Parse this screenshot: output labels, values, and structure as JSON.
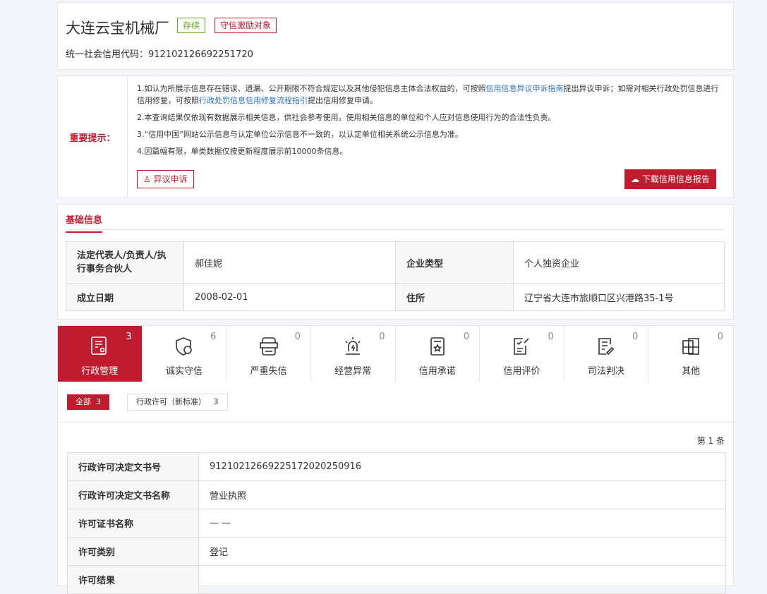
{
  "company": {
    "name": "大连云宝机械厂",
    "status_badge": "存续",
    "honor_badge": "守信激励对象",
    "credit_code_label": "统一社会信用代码：",
    "credit_code": "912102126692251720"
  },
  "notice": {
    "label": "重要提示：",
    "p1_a": "1.如认为所展示信息存在错误、遗漏、公开期限不符合规定以及其他侵犯信息主体合法权益的，可按照",
    "p1_link1": "信用信息异议申诉指南",
    "p1_b": "提出异议申诉；如需对相关行政处罚信息进行信用修复，可按照",
    "p1_link2": "行政处罚信息信用修复流程指引",
    "p1_c": "提出信用修复申请。",
    "p2": "2.本查询结果仅依现有数据展示相关信息，供社会参考使用。使用相关信息的单位和个人应对信息使用行为的合法性负责。",
    "p3": "3.“信用中国”网站公示信息与认定单位公示信息不一致的，以认定单位相关系统公示信息为准。",
    "p4": "4.因篇幅有限，单类数据仅按更新程度展示前10000条信息。",
    "objection_button": "异议申诉",
    "download_button": "下载信用信息报告"
  },
  "basic": {
    "title": "基础信息",
    "rows": [
      {
        "k1": "法定代表人/负责人/执行事务合伙人",
        "v1": "郝佳妮",
        "k2": "企业类型",
        "v2": "个人独资企业"
      },
      {
        "k1": "成立日期",
        "v1": "2008-02-01",
        "k2": "住所",
        "v2": "辽宁省大连市旅顺口区兴港路35-1号"
      }
    ]
  },
  "tabs": [
    {
      "label": "行政管理",
      "count": "3"
    },
    {
      "label": "诚实守信",
      "count": "6"
    },
    {
      "label": "严重失信",
      "count": "0"
    },
    {
      "label": "经营异常",
      "count": "0"
    },
    {
      "label": "信用承诺",
      "count": "0"
    },
    {
      "label": "信用评价",
      "count": "0"
    },
    {
      "label": "司法判决",
      "count": "0"
    },
    {
      "label": "其他",
      "count": "0"
    }
  ],
  "subtabs": [
    {
      "label": "全部",
      "count": "3"
    },
    {
      "label": "行政许可（新标准）",
      "count": "3"
    }
  ],
  "record": {
    "index": "第 1 条",
    "rows": [
      {
        "k": "行政许可决定文书号",
        "v": "91210212669225172020250916"
      },
      {
        "k": "行政许可决定文书名称",
        "v": "营业执照"
      },
      {
        "k": "许可证书名称",
        "v": "— —"
      },
      {
        "k": "许可类别",
        "v": "登记"
      },
      {
        "k": "许可结果",
        "v": ""
      }
    ]
  }
}
